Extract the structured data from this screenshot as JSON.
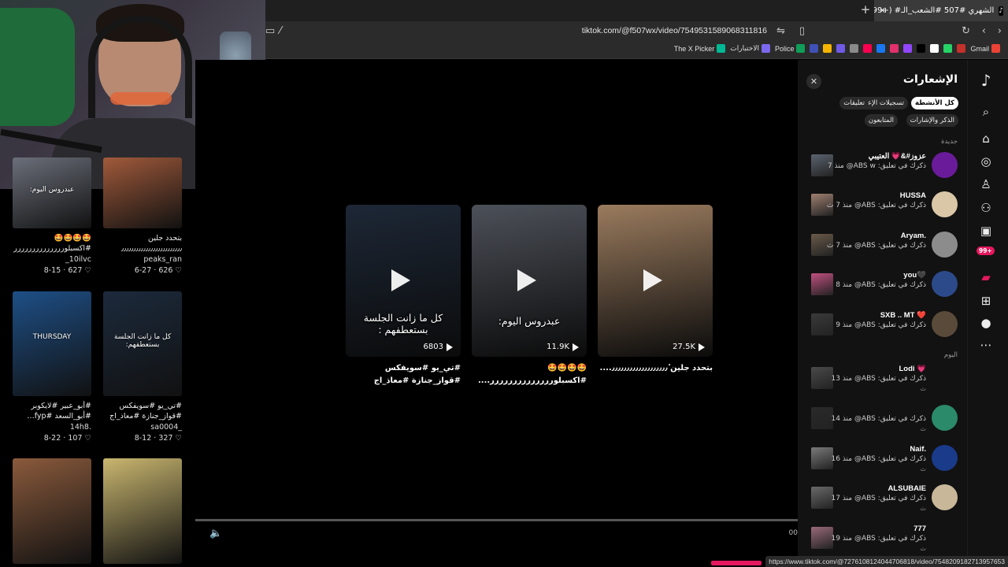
{
  "browser": {
    "tab_title": "(99+) #الشهري #507 #الشعب_الـ",
    "tab_icon": "tiktok-icon",
    "url": "tiktok.com/@f507wx/video/7549531589068311816",
    "status_url": "https://www.tiktok.com/@7276108124044706818/video/7548209182713957653",
    "bookmarks": [
      {
        "label": "Gmail",
        "color": "#ea4335"
      },
      {
        "label": "",
        "color": "#c4302b"
      },
      {
        "label": "",
        "color": "#25d366"
      },
      {
        "label": "",
        "color": "#ffffff"
      },
      {
        "label": "",
        "color": "#000000"
      },
      {
        "label": "",
        "color": "#9146ff"
      },
      {
        "label": "",
        "color": "#e1306c"
      },
      {
        "label": "",
        "color": "#1877f2"
      },
      {
        "label": "",
        "color": "#ff0050"
      },
      {
        "label": "",
        "color": "#8a8a8a"
      },
      {
        "label": "",
        "color": "#6e5ae6"
      },
      {
        "label": "",
        "color": "#f4b400"
      },
      {
        "label": "",
        "color": "#3f51b5"
      },
      {
        "label": "Police",
        "color": "#0f9d58"
      },
      {
        "label": "الاختبارات",
        "color": "#7b68ee"
      },
      {
        "label": "The X Picker",
        "color": "#00b894"
      }
    ]
  },
  "profile_grid": {
    "items": [
      {
        "caption": "🤩🤩🤩🤩 #اكسبلورررررررررررررر",
        "author": "_10ilvc",
        "likes": "627",
        "date": "8-15",
        "overlay": "عبدروس اليوم:",
        "color": "#6b6f7a"
      },
      {
        "caption": "بتحدد جلين ٔ٫٫٫٫٫٫٫٫٫٫٫٫٫٫٫٫٫٫٫٫٫٫٫٫٫",
        "author": "peaks_ran",
        "likes": "626",
        "date": "6-27",
        "overlay": "",
        "color": "#a15a3b"
      },
      {
        "caption": "#أبو_عبير #لايكوبر #أبو_السعد #fyp…",
        "author": "14h8.",
        "likes": "107",
        "date": "8-22",
        "overlay": "THURSDAY",
        "color": "#1e4f86"
      },
      {
        "caption": "#تي_يو #سويفكس #قواز_جنازة #معاذ_اج",
        "author": "sa0004_",
        "likes": "327",
        "date": "8-12",
        "overlay": "كل ما زانت الجلسة بستعطفهم:",
        "color": "#1c2a3c"
      },
      {
        "caption": "",
        "author": "",
        "likes": "",
        "date": "",
        "overlay": "",
        "color": "#8a5a3c"
      },
      {
        "caption": "",
        "author": "",
        "likes": "",
        "date": "",
        "overlay": "",
        "color": "#c9b66f"
      }
    ]
  },
  "player": {
    "cards": [
      {
        "overlay": "كل ما زانت الجلسة بستعطفهم :",
        "count": "6803",
        "caption": "#تي_يو #سويفكس #قواز_جنازة #معاذ_اج",
        "color": "#1d2736"
      },
      {
        "overlay": "عبدروس اليوم:",
        "count": "11.9K",
        "caption": "🤩🤩🤩🤩 #اكسبلورررررررررررررر....",
        "color": "#4c5058"
      },
      {
        "overlay": "",
        "count": "27.5K",
        "caption": "بتحدد جلين ٔ٫٫٫٫٫٫٫٫٫٫٫٫٫٫٫٫٫٫٫....",
        "color": "#9a7b5e"
      }
    ],
    "time": "00",
    "progress_fraction": 0.0
  },
  "notifications": {
    "title": "الإشعارات",
    "filters": [
      {
        "label": "كل الأنشطة",
        "active": true
      },
      {
        "label": "تسجيلات الإعجاب",
        "active": false
      },
      {
        "label": "تعليقات",
        "active": false
      },
      {
        "label": "الذكر والإشارات",
        "active": false
      },
      {
        "label": "المتابعون",
        "active": false
      }
    ],
    "section_new": "جديدة",
    "section_today": "اليوم",
    "items": [
      {
        "name": "عزوز#&💗 العتيبي",
        "text": "ذكرك في تعليق: ABS w@",
        "time": "منذ 7",
        "sub": "",
        "avatar_color": "#6a1b9a",
        "thumb_color": "#5c6470"
      },
      {
        "name": "HUSSA",
        "text": "ذكرك في تعليق: ABS@",
        "time": "منذ 7 ث",
        "sub": "",
        "avatar_color": "#d9c7a7",
        "thumb_color": "#a08070"
      },
      {
        "name": "Aryam.",
        "text": "ذكرك في تعليق: ABS@",
        "time": "منذ 7 ث",
        "sub": "",
        "avatar_color": "#8c8c8c",
        "thumb_color": "#6a5a4a"
      },
      {
        "name": "you🖤",
        "text": "ذكرك في تعليق: ABS@",
        "time": "منذ 8",
        "sub": "",
        "avatar_color": "#2c4a8a",
        "thumb_color": "#c05080"
      },
      {
        "name": "SXB .. MT ❤️",
        "text": "ذكرك في تعليق: ABS@",
        "time": "منذ 9",
        "sub": "",
        "avatar_color": "#5a4a3a",
        "thumb_color": "#3a3a3a"
      },
      {
        "name": "Lodi 💗",
        "text": "ذكرك في تعليق: ABS@",
        "time": "منذ 13",
        "sub": "ث",
        "avatar_color": "",
        "thumb_color": "#4a4a4a"
      },
      {
        "name": "",
        "text": "ذكرك في تعليق: ABS@",
        "time": "منذ 14",
        "sub": "ث",
        "avatar_color": "#2a8a6a",
        "thumb_color": "#2a2a2a"
      },
      {
        "name": "Naif.",
        "text": "ذكرك في تعليق: ABS@",
        "time": "منذ 16",
        "sub": "ث",
        "avatar_color": "#1a3a8a",
        "thumb_color": "#7a7a7a"
      },
      {
        "name": "ALSUBAIE",
        "text": "ذكرك في تعليق: ABS@",
        "time": "منذ 17",
        "sub": "ث",
        "avatar_color": "#c9b79a",
        "thumb_color": "#6a6a6a"
      },
      {
        "name": "777",
        "text": "ذكرك في تعليق: ABS@",
        "time": "منذ 19",
        "sub": "ث",
        "avatar_color": "",
        "thumb_color": "#9a6a7a"
      }
    ]
  },
  "rail": {
    "badge": "99+",
    "icons": [
      "tiktok-logo-icon",
      "search-icon",
      "home-icon",
      "explore-icon",
      "following-icon",
      "friends-icon",
      "live-icon",
      "inbox-icon",
      "messages-icon",
      "upload-icon",
      "profile-icon",
      "more-icon"
    ]
  }
}
